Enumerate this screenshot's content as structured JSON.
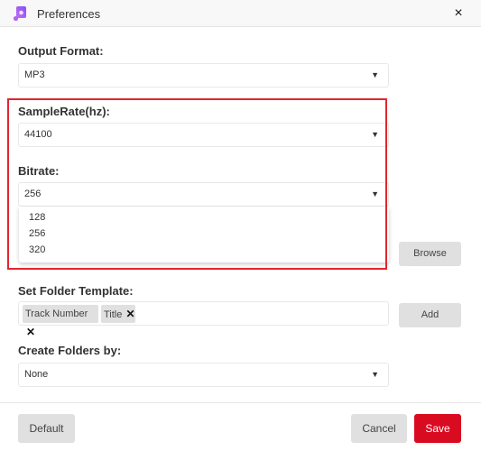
{
  "window": {
    "title": "Preferences",
    "icon": "music-note-icon",
    "close_icon": "×"
  },
  "output_format": {
    "label": "Output Format:",
    "value": "MP3"
  },
  "sample_rate": {
    "label": "SampleRate(hz):",
    "value": "44100"
  },
  "bitrate": {
    "label": "Bitrate:",
    "value": "256",
    "options": [
      "128",
      "256",
      "320"
    ]
  },
  "output_folder": {
    "browse_label": "Browse"
  },
  "folder_template": {
    "label": "Set Folder Template:",
    "tags": [
      "Track Number",
      "Title"
    ],
    "tag_remove_glyph": "✕",
    "add_label": "Add"
  },
  "create_folders": {
    "label": "Create Folders by:",
    "value": "None"
  },
  "footer": {
    "default_label": "Default",
    "cancel_label": "Cancel",
    "save_label": "Save"
  },
  "colors": {
    "accent": "#d90b21",
    "highlight_border": "#e2252f",
    "icon_purple": "#a65cf0"
  },
  "dropdown_arrow": "▼"
}
